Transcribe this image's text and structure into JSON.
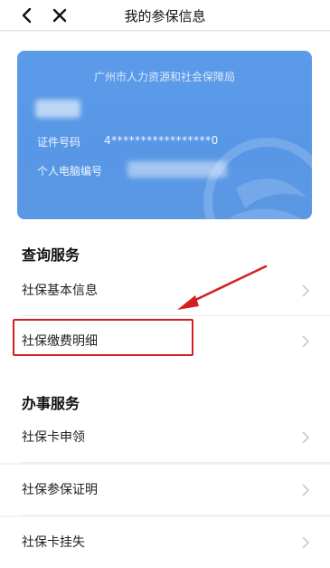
{
  "nav": {
    "title": "我的参保信息"
  },
  "card": {
    "org": "广州市人力资源和社会保障局",
    "id_label": "证件号码",
    "id_value": "4*****************0",
    "pc_label": "个人电脑编号"
  },
  "query": {
    "title": "查询服务",
    "items": [
      {
        "label": "社保基本信息"
      },
      {
        "label": "社保缴费明细"
      }
    ]
  },
  "office": {
    "title": "办事服务",
    "items": [
      {
        "label": "社保卡申领"
      },
      {
        "label": "社保参保证明"
      },
      {
        "label": "社保卡挂失"
      }
    ]
  },
  "colors": {
    "card": "#5897e6",
    "highlight": "#d51f1f"
  }
}
